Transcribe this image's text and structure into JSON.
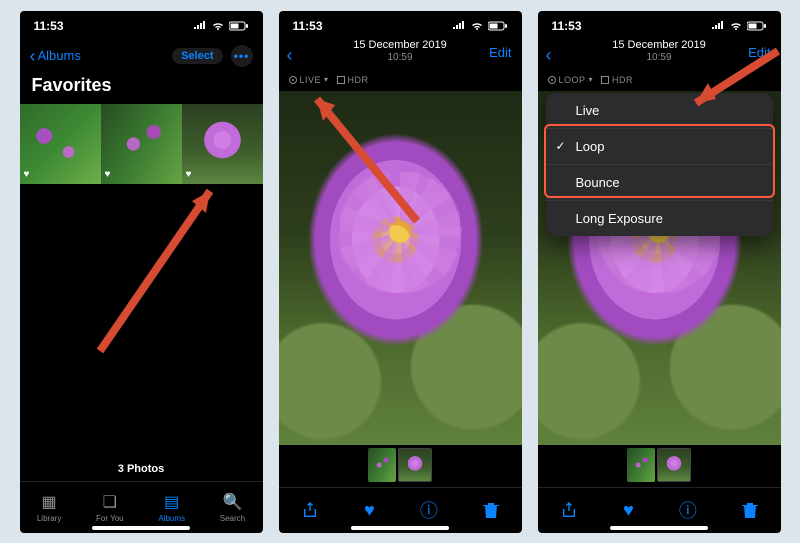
{
  "status": {
    "time": "11:53"
  },
  "screen1": {
    "back_label": "Albums",
    "select_label": "Select",
    "title": "Favorites",
    "count": "3 Photos",
    "tabs": {
      "library": "Library",
      "foryou": "For You",
      "albums": "Albums",
      "search": "Search"
    }
  },
  "detail": {
    "date": "15 December 2019",
    "time": "10:59",
    "edit": "Edit",
    "badges": {
      "live": "LIVE",
      "loop": "LOOP",
      "hdr": "HDR"
    }
  },
  "menu": {
    "options": [
      "Live",
      "Loop",
      "Bounce",
      "Long Exposure"
    ],
    "selected": "Loop"
  }
}
